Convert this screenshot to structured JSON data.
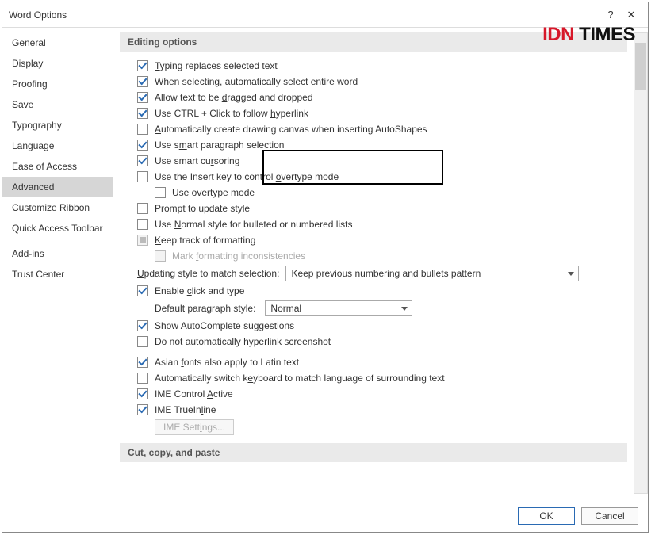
{
  "window": {
    "title": "Word Options"
  },
  "sidebar": {
    "items": [
      {
        "label": "General"
      },
      {
        "label": "Display"
      },
      {
        "label": "Proofing"
      },
      {
        "label": "Save"
      },
      {
        "label": "Typography"
      },
      {
        "label": "Language"
      },
      {
        "label": "Ease of Access"
      },
      {
        "label": "Advanced",
        "selected": true
      },
      {
        "label": "Customize Ribbon"
      },
      {
        "label": "Quick Access Toolbar"
      },
      {
        "label": "Add-ins"
      },
      {
        "label": "Trust Center"
      }
    ]
  },
  "sections": {
    "editing_header": "Editing options",
    "ccp_header": "Cut, copy, and paste"
  },
  "opts": {
    "typingReplaces_pre": "T",
    "typingReplaces_post": "yping replaces selected text",
    "whenSelecting_pre": "When selecting, automatically select entire ",
    "whenSelecting_u": "w",
    "whenSelecting_post": "ord",
    "allowDrag_pre": "Allow text to be ",
    "allowDrag_u": "d",
    "allowDrag_post": "ragged and dropped",
    "ctrlClick_pre": "Use CTRL + Click to follow ",
    "ctrlClick_u": "h",
    "ctrlClick_post": "yperlink",
    "autoCanvas_pre": "A",
    "autoCanvas_post": "utomatically create drawing canvas when inserting AutoShapes",
    "smartPara_pre": "Use s",
    "smartPara_u": "m",
    "smartPara_post": "art paragraph selection",
    "smartCursor_pre": "Use smart cu",
    "smartCursor_u": "r",
    "smartCursor_post": "soring",
    "insertKey_pre": "Use the Insert key to control ",
    "insertKey_u": "o",
    "insertKey_post": "vertype mode",
    "overtype_pre": "Use ov",
    "overtype_u": "e",
    "overtype_post": "rtype mode",
    "promptUpdate": "Prompt to update style",
    "useNormal_pre": "Use ",
    "useNormal_u": "N",
    "useNormal_post": "ormal style for bulleted or numbered lists",
    "keepTrack_u": "K",
    "keepTrack_post": "eep track of formatting",
    "markFmt_pre": "Mark ",
    "markFmt_u": "f",
    "markFmt_post": "ormatting inconsistencies",
    "updatingStyle_u": "U",
    "updatingStyle_post": "pdating style to match selection:",
    "updatingStyleValue": "Keep previous numbering and bullets pattern",
    "enableClickType_pre": "Enable ",
    "enableClickType_u": "c",
    "enableClickType_post": "lick and type",
    "defaultParaLabel": "Default paragraph style:",
    "defaultParaValue": "Normal",
    "showAutoComplete": "Show AutoComplete suggestions",
    "noAutoHyperlink_pre": "Do not automatically ",
    "noAutoHyperlink_u": "h",
    "noAutoHyperlink_post": "yperlink screenshot",
    "asianFonts_pre": "Asian ",
    "asianFonts_u": "f",
    "asianFonts_post": "onts also apply to Latin text",
    "autoSwitchKb_pre": "Automatically switch k",
    "autoSwitchKb_u": "e",
    "autoSwitchKb_post": "yboard to match language of surrounding text",
    "imeActive_pre": "IME Control ",
    "imeActive_u": "A",
    "imeActive_post": "ctive",
    "imeTrueInline_pre": "IME TrueIn",
    "imeTrueInline_u": "l",
    "imeTrueInline_post": "ine",
    "imeSettings_pre": "IME Sett",
    "imeSettings_u": "i",
    "imeSettings_post": "ngs..."
  },
  "footer": {
    "ok": "OK",
    "cancel": "Cancel"
  },
  "watermark": {
    "idn": "IDN",
    "times": "TIMES"
  }
}
